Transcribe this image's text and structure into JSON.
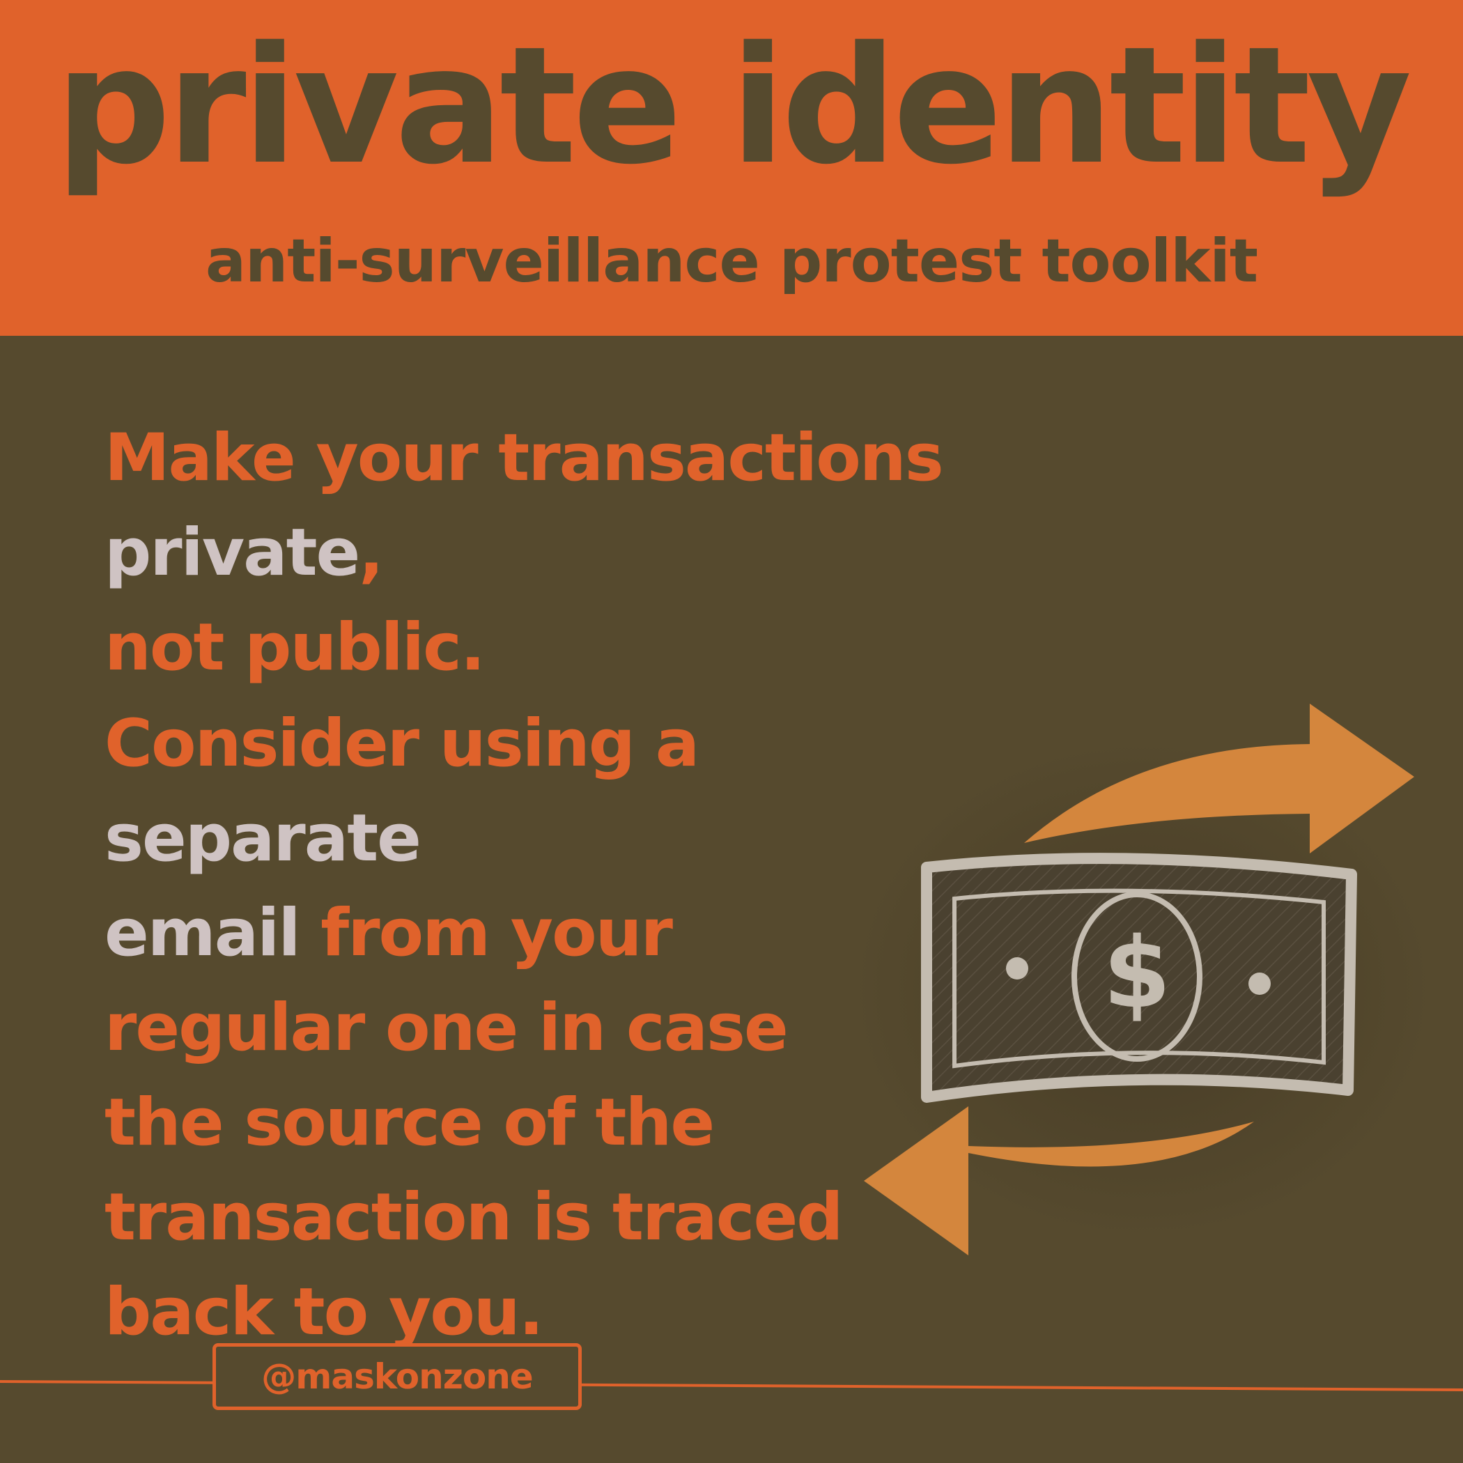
{
  "header": {
    "title": "private identity",
    "subtitle": "anti-surveillance protest toolkit"
  },
  "paragraph1": {
    "part1": "Make your transactions ",
    "highlight1": "private",
    "part2": ",",
    "part3": "not public."
  },
  "paragraph2": {
    "part1": "Consider using a ",
    "highlight1": "separate",
    "highlight2": "email",
    "part2": " from your",
    "line3": "regular one in case",
    "line4": "the source of the",
    "line5": "transaction is traced",
    "line6": "back to you."
  },
  "illustration": {
    "icon": "money-exchange-icon",
    "symbol": "$"
  },
  "footer": {
    "handle": "@maskonzone"
  },
  "colors": {
    "background": "#564a2e",
    "accent": "#e0622b",
    "highlight": "#cfc3c3",
    "arrow": "#d4863d",
    "bill": "#c4bcb0"
  }
}
